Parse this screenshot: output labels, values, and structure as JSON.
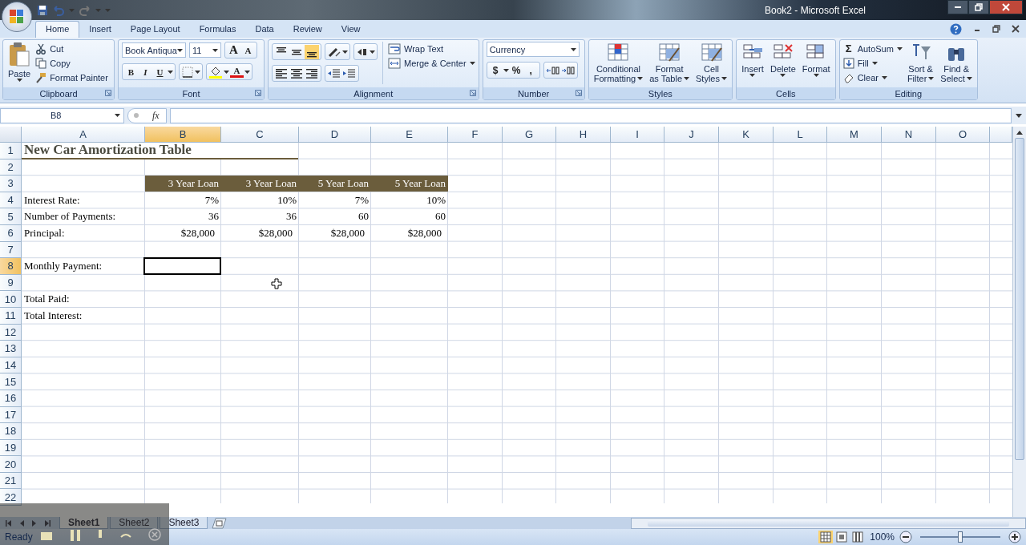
{
  "window": {
    "title": "Book2 - Microsoft Excel"
  },
  "ribbon_tabs": [
    {
      "label": "Home",
      "selected": true
    },
    {
      "label": "Insert",
      "selected": false
    },
    {
      "label": "Page Layout",
      "selected": false
    },
    {
      "label": "Formulas",
      "selected": false
    },
    {
      "label": "Data",
      "selected": false
    },
    {
      "label": "Review",
      "selected": false
    },
    {
      "label": "View",
      "selected": false
    }
  ],
  "clipboard": {
    "name": "Clipboard",
    "paste": "Paste",
    "small": [
      "Cut",
      "Copy",
      "Format Painter"
    ]
  },
  "font": {
    "name": "Font",
    "family": "Book Antiqua",
    "size": "11",
    "grow": "A",
    "shrink": "A",
    "styles": [
      "B",
      "I",
      "U"
    ],
    "color_button": "A"
  },
  "alignment": {
    "name": "Alignment",
    "vertical": [
      {
        "selected": false
      },
      {
        "selected": false
      },
      {
        "selected": true
      }
    ],
    "wrap": "Wrap Text",
    "merge": "Merge & Center"
  },
  "number": {
    "name": "Number",
    "format": "Currency",
    "symbols": [
      "$",
      "%",
      ","
    ]
  },
  "styles": {
    "name": "Styles",
    "buttons": [
      [
        "Conditional",
        "Formatting"
      ],
      [
        "Format",
        "as Table"
      ],
      [
        "Cell",
        "Styles"
      ]
    ]
  },
  "cells": {
    "name": "Cells",
    "buttons": [
      "Insert",
      "Delete",
      "Format"
    ]
  },
  "editing": {
    "name": "Editing",
    "sum": "Σ",
    "small": [
      "AutoSum",
      "Fill",
      "Clear"
    ],
    "large": [
      [
        "Sort &",
        "Filter"
      ],
      [
        "Find &",
        "Select"
      ]
    ]
  },
  "formula_bar": {
    "name_box": "B8",
    "fx": "fx"
  },
  "columns": [
    {
      "label": "A",
      "selected": false
    },
    {
      "label": "B",
      "selected": true
    },
    {
      "label": "C",
      "selected": false
    },
    {
      "label": "D",
      "selected": false
    },
    {
      "label": "E",
      "selected": false
    },
    {
      "label": "F",
      "selected": false
    },
    {
      "label": "G",
      "selected": false
    },
    {
      "label": "H",
      "selected": false
    },
    {
      "label": "I",
      "selected": false
    },
    {
      "label": "J",
      "selected": false
    },
    {
      "label": "K",
      "selected": false
    },
    {
      "label": "L",
      "selected": false
    },
    {
      "label": "M",
      "selected": false
    },
    {
      "label": "N",
      "selected": false
    },
    {
      "label": "O",
      "selected": false
    }
  ],
  "rows": [
    {
      "header": "1",
      "selected": false,
      "kind": "title",
      "title": "New Car Amortization Table"
    },
    {
      "header": "2",
      "selected": false,
      "kind": "blank"
    },
    {
      "header": "3",
      "selected": false,
      "kind": "headings",
      "values": [
        "3 Year Loan",
        "3 Year Loan",
        "5 Year Loan",
        "5 Year Loan"
      ]
    },
    {
      "header": "4",
      "selected": false,
      "kind": "data",
      "label": "Interest Rate:",
      "values": [
        "7%",
        "10%",
        "7%",
        "10%"
      ]
    },
    {
      "header": "5",
      "selected": false,
      "kind": "data",
      "label": "Number of Payments:",
      "values": [
        "36",
        "36",
        "60",
        "60"
      ]
    },
    {
      "header": "6",
      "selected": false,
      "kind": "currency",
      "label": "Principal:",
      "values": [
        "$28,000",
        "$28,000",
        "$28,000",
        "$28,000"
      ]
    },
    {
      "header": "7",
      "selected": false,
      "kind": "blank"
    },
    {
      "header": "8",
      "selected": true,
      "kind": "data",
      "label": "Monthly Payment:"
    },
    {
      "header": "9",
      "selected": false,
      "kind": "blank"
    },
    {
      "header": "10",
      "selected": false,
      "kind": "data",
      "label": "Total Paid:"
    },
    {
      "header": "11",
      "selected": false,
      "kind": "data",
      "label": "Total Interest:"
    },
    {
      "header": "12",
      "selected": false,
      "kind": "blank"
    },
    {
      "header": "13",
      "selected": false,
      "kind": "blank"
    },
    {
      "header": "14",
      "selected": false,
      "kind": "blank"
    },
    {
      "header": "15",
      "selected": false,
      "kind": "blank"
    },
    {
      "header": "16",
      "selected": false,
      "kind": "blank"
    },
    {
      "header": "17",
      "selected": false,
      "kind": "blank"
    },
    {
      "header": "18",
      "selected": false,
      "kind": "blank"
    },
    {
      "header": "19",
      "selected": false,
      "kind": "blank"
    },
    {
      "header": "20",
      "selected": false,
      "kind": "blank"
    },
    {
      "header": "21",
      "selected": false,
      "kind": "blank"
    },
    {
      "header": "22",
      "selected": false,
      "kind": "blank"
    }
  ],
  "sheet_tabs": [
    {
      "label": "Sheet1",
      "selected": true
    },
    {
      "label": "Sheet2",
      "selected": false
    },
    {
      "label": "Sheet3",
      "selected": false
    }
  ],
  "status_bar": {
    "status": "Ready",
    "views": [
      {
        "selected": true
      },
      {
        "selected": false
      },
      {
        "selected": false
      }
    ],
    "zoom": "100%",
    "zoom_level": {
      "level": 0.5
    }
  }
}
